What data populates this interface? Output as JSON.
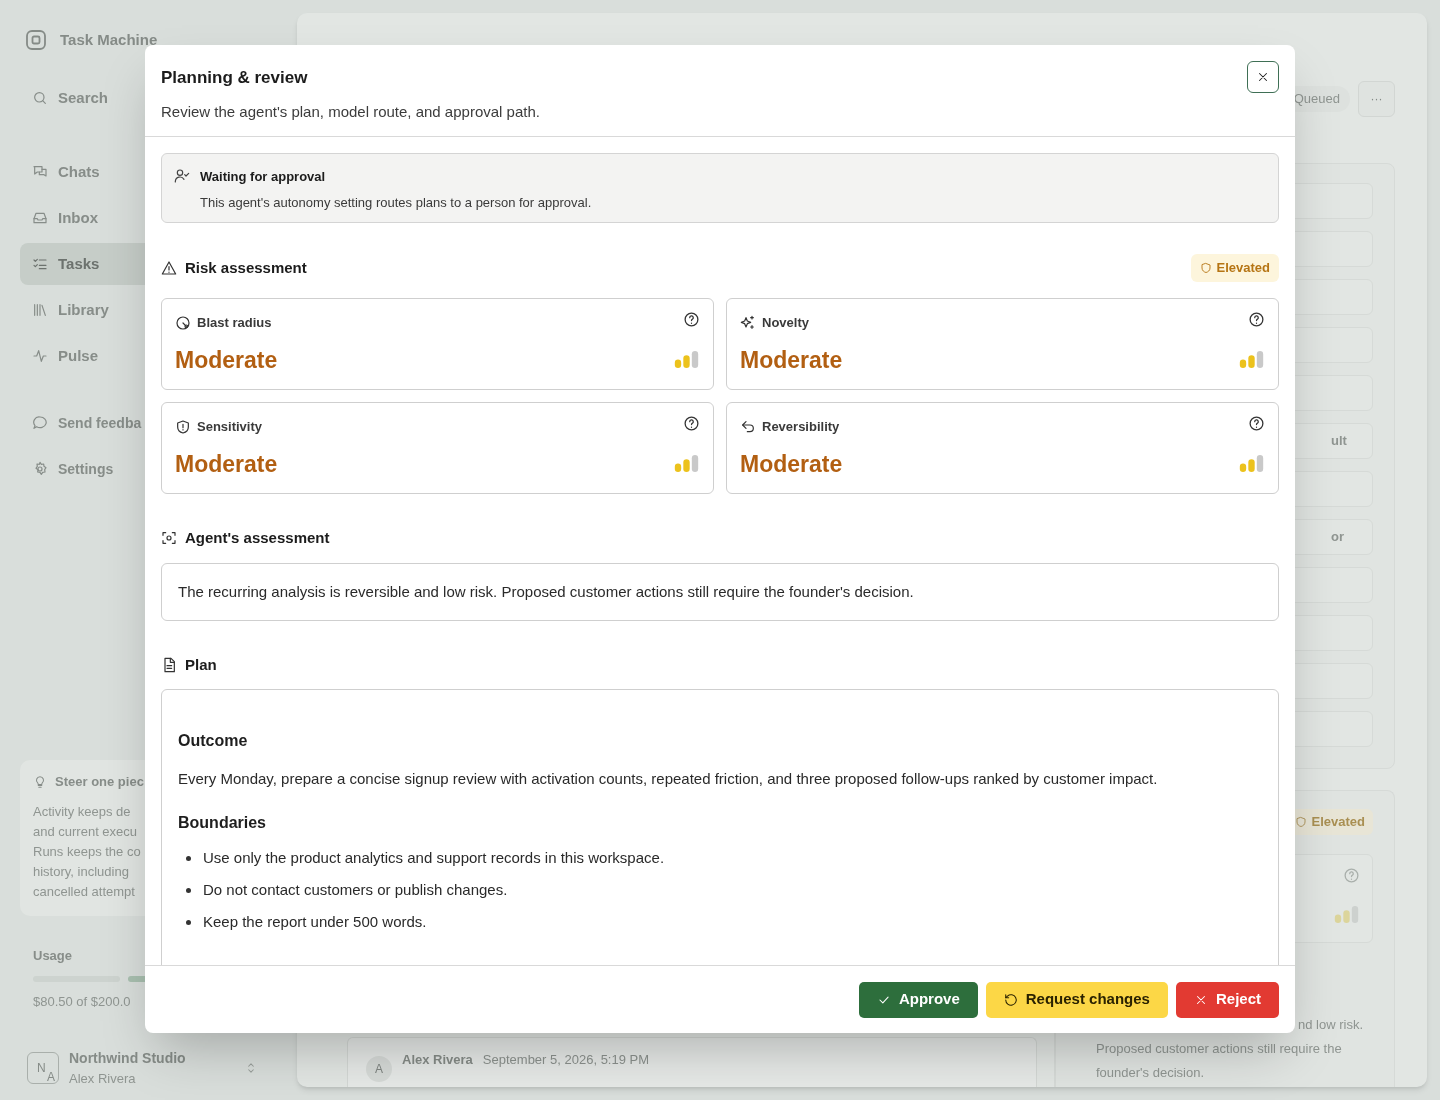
{
  "sidebar": {
    "app_name": "Task Machine",
    "search_label": "Search",
    "items": [
      {
        "label": "Chats",
        "kind": "chats",
        "selected": false
      },
      {
        "label": "Inbox",
        "kind": "inbox",
        "selected": false
      },
      {
        "label": "Tasks",
        "kind": "tasks",
        "selected": true
      },
      {
        "label": "Library",
        "kind": "library",
        "selected": false
      },
      {
        "label": "Pulse",
        "kind": "pulse",
        "selected": false
      }
    ],
    "footer_items": [
      {
        "label": "Send feedba",
        "kind": "feedback"
      },
      {
        "label": "Settings",
        "kind": "settings"
      }
    ],
    "tip": {
      "title": "Steer one piec",
      "lines": [
        "Activity keeps de",
        "and current execu",
        "Runs keeps the co",
        "history, including",
        "cancelled attempt"
      ]
    },
    "usage": {
      "label": "Usage",
      "reading": "$80.50 of $200.0"
    },
    "workspace": {
      "initials": [
        "N",
        "A"
      ],
      "name": "Northwind Studio",
      "user": "Alex Rivera"
    }
  },
  "background": {
    "status_badge": "Queued",
    "more_button": "···",
    "step_rows": [
      {
        "kind": "row"
      },
      {
        "kind": "row"
      },
      {
        "kind": "row"
      },
      {
        "kind": "row"
      },
      {
        "kind": "row"
      },
      {
        "kind": "row",
        "text": "ult"
      },
      {
        "kind": "row"
      },
      {
        "kind": "row",
        "text": "or"
      },
      {
        "kind": "row"
      },
      {
        "kind": "row"
      },
      {
        "kind": "row"
      },
      {
        "kind": "row"
      }
    ],
    "risk_badge": "Elevated",
    "assessment_lines": [
      "nd low risk.",
      "Proposed customer actions still require the",
      "founder's decision."
    ],
    "comment": {
      "avatar": "A",
      "author": "Alex Rivera",
      "time": "September 5, 2026, 5:19 PM"
    }
  },
  "dialog": {
    "title": "Planning & review",
    "subtitle": "Review the agent's plan, model route, and approval path.",
    "notice": {
      "title": "Waiting for approval",
      "text": "This agent's autonomy setting routes plans to a person for approval."
    },
    "risk": {
      "title": "Risk assessment",
      "badge": "Elevated",
      "factors": [
        {
          "label": "Blast radius",
          "kind": "radius",
          "value": "Moderate",
          "level": 0.67
        },
        {
          "label": "Novelty",
          "kind": "novelty",
          "value": "Moderate",
          "level": 0.67
        },
        {
          "label": "Sensitivity",
          "kind": "sensitivity",
          "value": "Moderate",
          "level": 0.67
        },
        {
          "label": "Reversibility",
          "kind": "reversibility",
          "value": "Moderate",
          "level": 0.67
        }
      ]
    },
    "assessment": {
      "title": "Agent's assessment",
      "text": "The recurring analysis is reversible and low risk. Proposed customer actions still require the founder's decision."
    },
    "plan": {
      "title": "Plan",
      "sections": [
        {
          "heading": "Outcome",
          "text": "Every Monday, prepare a concise signup review with activation counts, repeated friction, and three proposed follow-ups ranked by customer impact."
        },
        {
          "heading": "Boundaries",
          "items": [
            "Use only the product analytics and support records in this workspace.",
            "Do not contact customers or publish changes.",
            "Keep the report under 500 words."
          ]
        }
      ]
    },
    "buttons": [
      {
        "label": "Approve",
        "kind": "approve"
      },
      {
        "label": "Request changes",
        "kind": "changes"
      },
      {
        "label": "Reject",
        "kind": "reject"
      }
    ]
  }
}
